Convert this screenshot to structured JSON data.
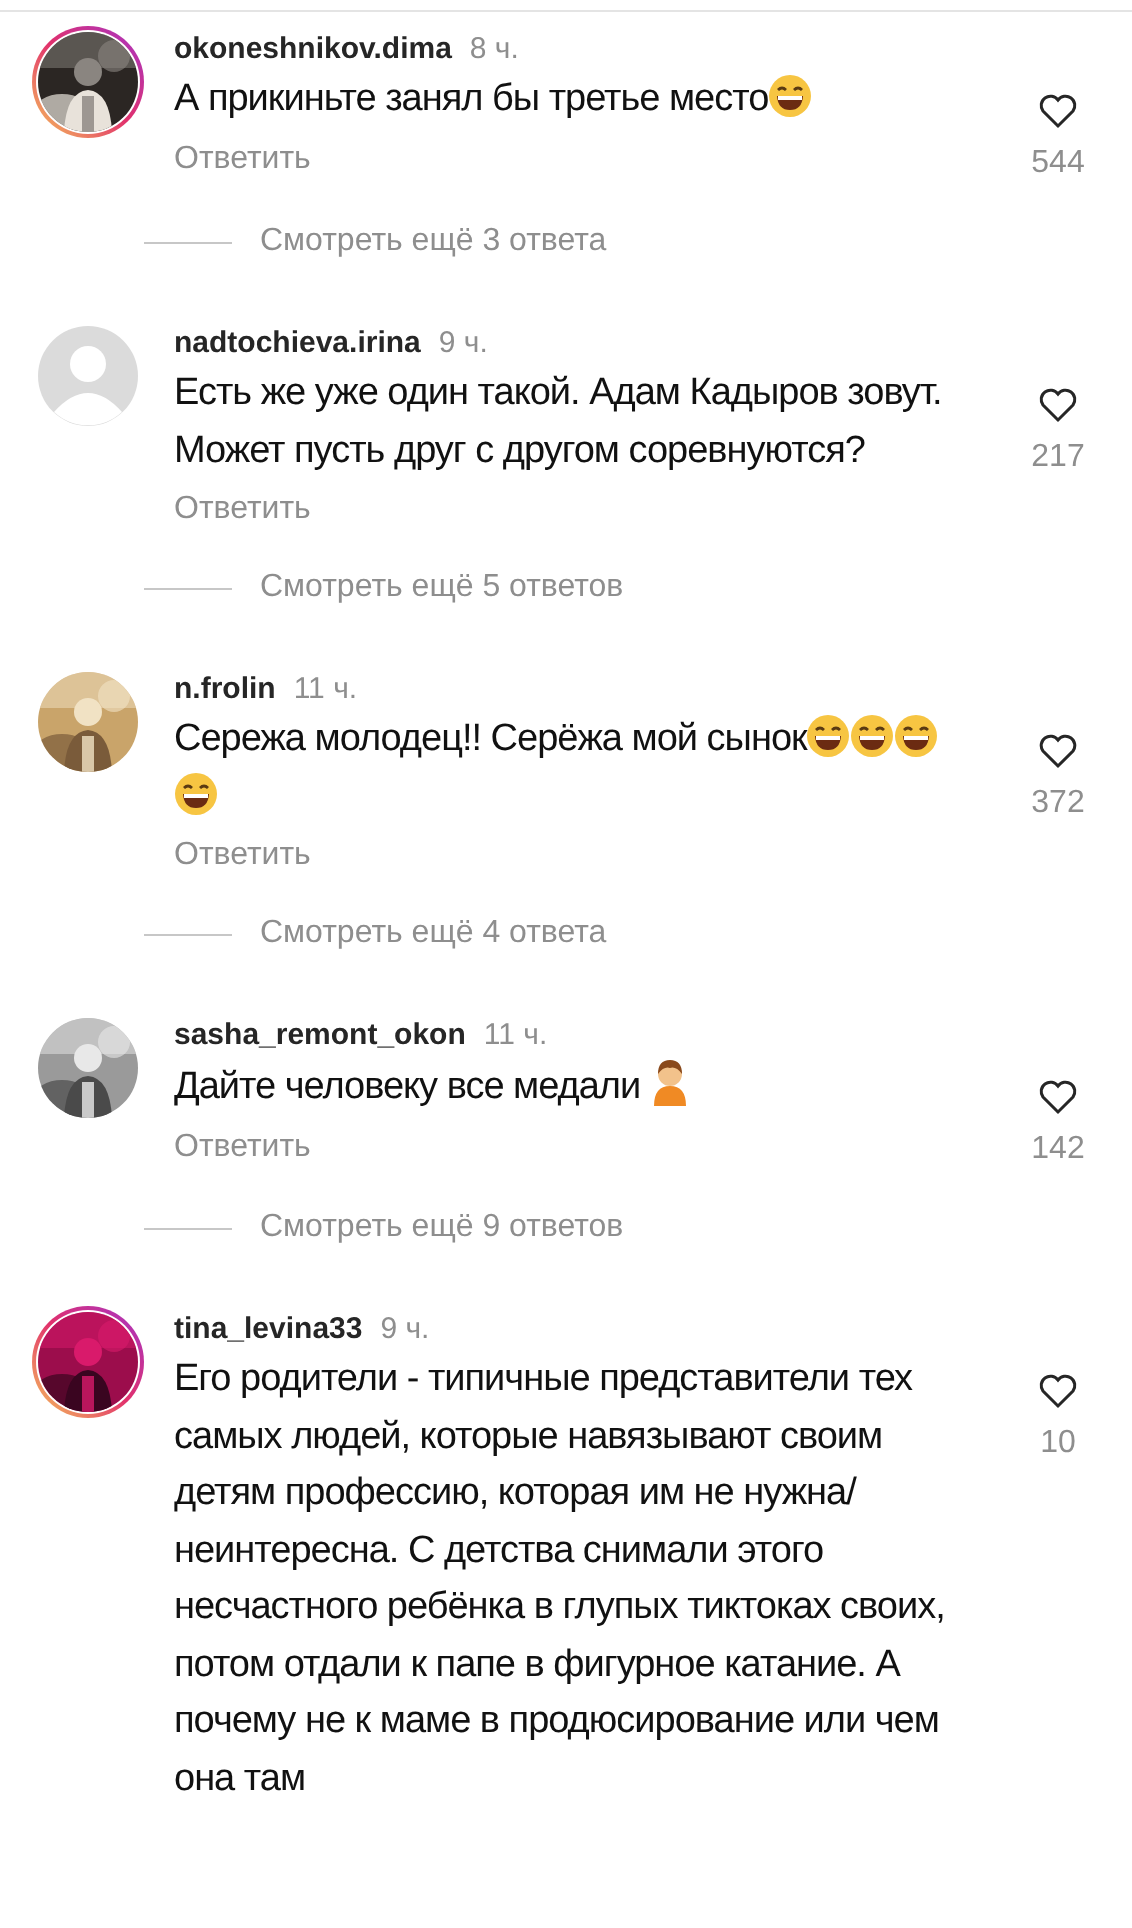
{
  "comments": [
    {
      "username": "okoneshnikov.dima",
      "time": "8 ч.",
      "avatar": {
        "kind": "picture",
        "story_ring": true
      },
      "parts": [
        {
          "kind": "text",
          "text": "А прикиньте занял бы третье место"
        },
        {
          "kind": "laugh"
        }
      ],
      "reply": "Ответить",
      "liked": false,
      "likes": "544",
      "more_replies": "Смотреть ещё 3 ответа"
    },
    {
      "username": "nadtochieva.irina",
      "time": "9 ч.",
      "avatar": {
        "kind": "default",
        "story_ring": false
      },
      "parts": [
        {
          "kind": "text",
          "text": "Есть же уже один такой. Адам Кадыров зовут. Может пусть друг с другом соревнуются?"
        }
      ],
      "reply": "Ответить",
      "liked": false,
      "likes": "217",
      "more_replies": "Смотреть ещё 5 ответов"
    },
    {
      "username": "n.frolin",
      "time": "11 ч.",
      "avatar": {
        "kind": "picture",
        "story_ring": false
      },
      "parts": [
        {
          "kind": "text",
          "text": "Сережа молодец!! Серёжа мой сынок"
        },
        {
          "kind": "laugh"
        },
        {
          "kind": "laugh"
        },
        {
          "kind": "laugh"
        },
        {
          "kind": "laugh"
        }
      ],
      "reply": "Ответить",
      "liked": false,
      "likes": "372",
      "more_replies": "Смотреть ещё 4 ответа"
    },
    {
      "username": "sasha_remont_okon",
      "time": "11 ч.",
      "avatar": {
        "kind": "picture",
        "story_ring": false
      },
      "parts": [
        {
          "kind": "text",
          "text": "Дайте человеку все медали "
        },
        {
          "kind": "person"
        }
      ],
      "reply": "Ответить",
      "liked": false,
      "likes": "142",
      "more_replies": "Смотреть ещё 9 ответов"
    },
    {
      "username": "tina_levina33",
      "time": "9 ч.",
      "avatar": {
        "kind": "picture",
        "story_ring": true
      },
      "parts": [
        {
          "kind": "text",
          "text": "Его родители - типичные представители тех самых людей, которые навязывают своим детям профессию, которая им не нужна/неинтересна. С детства снимали этого несчастного ребёнка в глупых тиктоках своих, потом отдали к папе в фигурное катание. А почему не к маме в продюсирование или чем она там"
        }
      ],
      "liked": false,
      "likes": "10"
    }
  ]
}
